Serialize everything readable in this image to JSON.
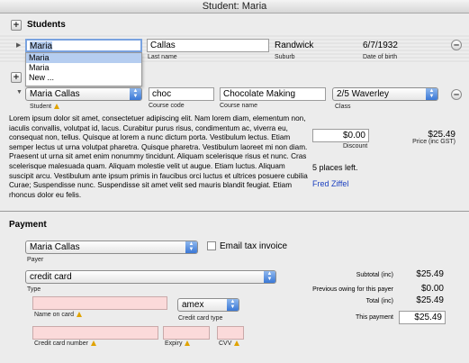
{
  "window": {
    "title": "Student: Maria"
  },
  "students": {
    "header": "Students",
    "row1": {
      "first_name": "Maria",
      "last_name": "Callas",
      "last_name_label": "Last name",
      "suburb": "Randwick",
      "suburb_label": "Suburb",
      "dob": "6/7/1932",
      "dob_label": "Date of birth"
    },
    "dropdown": [
      "Maria",
      "Maria",
      "New ..."
    ]
  },
  "enrolment": {
    "student": "Maria   Callas",
    "student_label": "Student",
    "course_code": "choc",
    "course_code_label": "Course code",
    "course_name": "Chocolate Making",
    "course_name_label": "Course name",
    "class": "2/5 Waverley",
    "class_label": "Class",
    "description": "Lorem ipsum dolor sit amet, consectetuer adipiscing elit. Nam lorem diam, elementum non, iaculis convallis, volutpat id, lacus. Curabitur purus risus, condimentum ac, viverra eu, consequat non, tellus. Quisque at lorem a nunc dictum porta. Vestibulum lectus. Etiam semper lectus ut urna volutpat pharetra. Quisque pharetra. Vestibulum laoreet mi non diam. Praesent ut urna sit amet enim nonummy tincidunt. Aliquam scelerisque risus et nunc. Cras scelerisque malesuada quam. Aliquam molestie velit ut augue. Etiam luctus. Aliquam suscipit arcu. Vestibulum ante ipsum primis in faucibus orci luctus et ultrices posuere cubilia Curae; Suspendisse nunc. Suspendisse sit amet velit sed mauris blandit feugiat. Etiam rhoncus dolor eu felis.",
    "discount": "$0.00",
    "discount_label": "Discount",
    "price": "$25.49",
    "price_label": "Price (inc GST)",
    "places_left": "5 places left.",
    "tutor": "Fred Ziffel"
  },
  "payment": {
    "header": "Payment",
    "payer": "Maria   Callas",
    "payer_label": "Payer",
    "email_tax_invoice": "Email tax invoice",
    "type": "credit card",
    "type_label": "Type",
    "name_on_card_label": "Name on card",
    "card_type": "amex",
    "card_type_label": "Credit card type",
    "card_number_label": "Credit card number",
    "expiry_label": "Expiry",
    "cvv_label": "CVV",
    "subtotal_label": "Subtotal (inc)",
    "subtotal": "$25.49",
    "prev_owing_label": "Previous owing for this payer",
    "prev_owing": "$0.00",
    "total_label": "Total (inc)",
    "total": "$25.49",
    "this_payment_label": "This payment",
    "this_payment": "$25.49"
  },
  "icons": {
    "add": "plus-icon",
    "remove": "minus-icon",
    "warning": "warning-icon",
    "disclosure": "triangle-icon",
    "popup": "updown-arrows-icon"
  },
  "colors": {
    "required_field": "#fbdada",
    "selection": "#b5cdf0",
    "link": "#1a3fc0",
    "popup_arrow": "#3a78d6"
  }
}
